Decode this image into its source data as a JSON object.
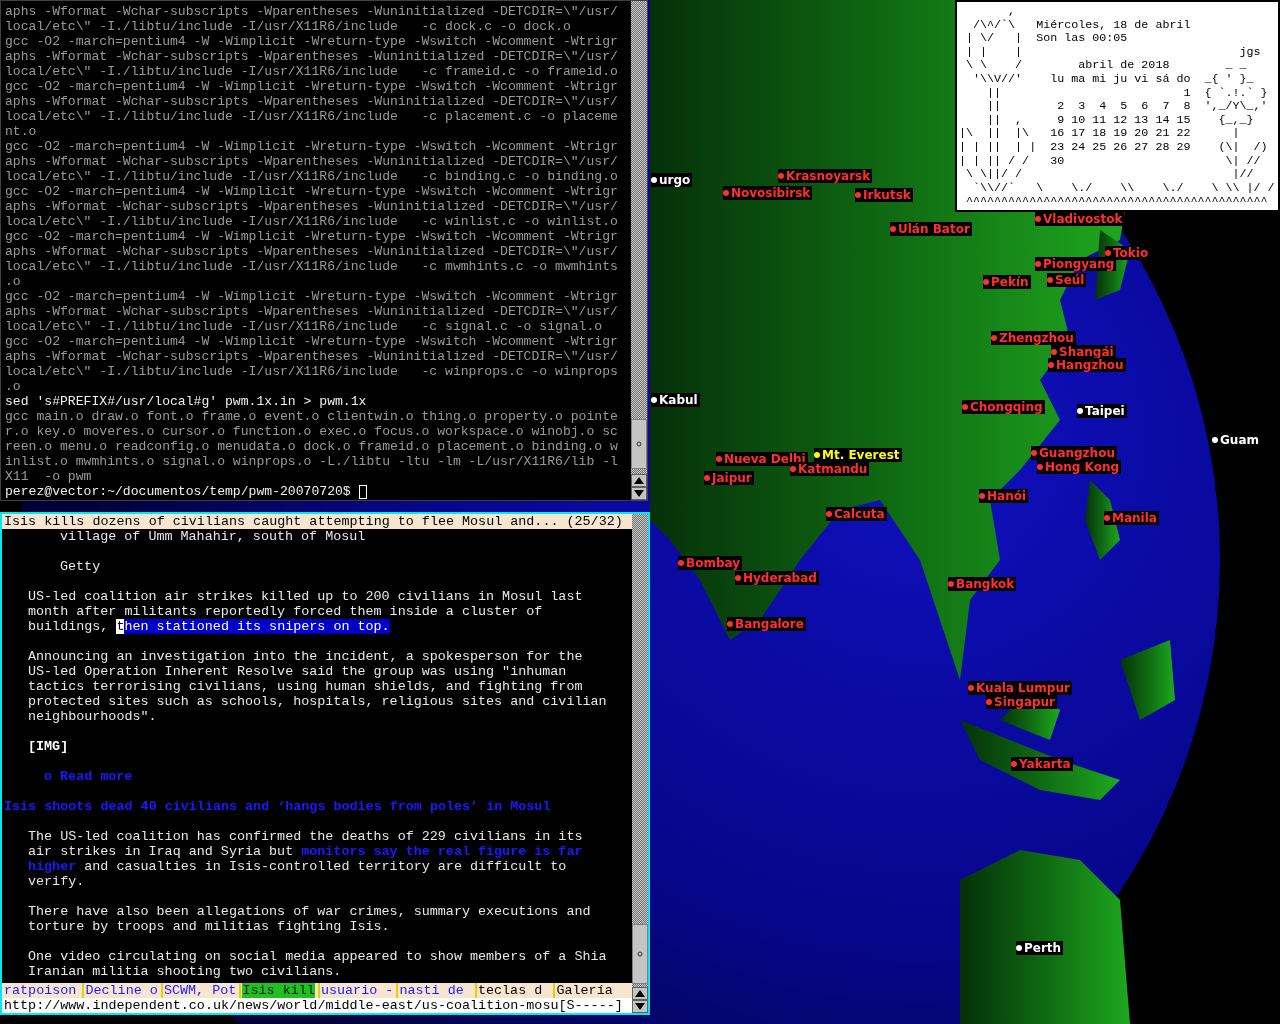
{
  "terminal": {
    "lines": [
      {
        "text": "aphs -Wformat -Wchar-subscripts -Wparentheses -Wuninitialized -DETCDIR=\\\"/usr/",
        "kind": "output"
      },
      {
        "text": "local/etc\\\" -I./libtu/include -I/usr/X11R6/include   -c dock.c -o dock.o",
        "kind": "output"
      },
      {
        "text": "gcc -O2 -march=pentium4 -W -Wimplicit -Wreturn-type -Wswitch -Wcomment -Wtrigr",
        "kind": "output"
      },
      {
        "text": "aphs -Wformat -Wchar-subscripts -Wparentheses -Wuninitialized -DETCDIR=\\\"/usr/",
        "kind": "output"
      },
      {
        "text": "local/etc\\\" -I./libtu/include -I/usr/X11R6/include   -c frameid.c -o frameid.o",
        "kind": "output"
      },
      {
        "text": "gcc -O2 -march=pentium4 -W -Wimplicit -Wreturn-type -Wswitch -Wcomment -Wtrigr",
        "kind": "output"
      },
      {
        "text": "aphs -Wformat -Wchar-subscripts -Wparentheses -Wuninitialized -DETCDIR=\\\"/usr/",
        "kind": "output"
      },
      {
        "text": "local/etc\\\" -I./libtu/include -I/usr/X11R6/include   -c placement.c -o placeme",
        "kind": "output"
      },
      {
        "text": "nt.o",
        "kind": "output"
      },
      {
        "text": "gcc -O2 -march=pentium4 -W -Wimplicit -Wreturn-type -Wswitch -Wcomment -Wtrigr",
        "kind": "output"
      },
      {
        "text": "aphs -Wformat -Wchar-subscripts -Wparentheses -Wuninitialized -DETCDIR=\\\"/usr/",
        "kind": "output"
      },
      {
        "text": "local/etc\\\" -I./libtu/include -I/usr/X11R6/include   -c binding.c -o binding.o",
        "kind": "output"
      },
      {
        "text": "gcc -O2 -march=pentium4 -W -Wimplicit -Wreturn-type -Wswitch -Wcomment -Wtrigr",
        "kind": "output"
      },
      {
        "text": "aphs -Wformat -Wchar-subscripts -Wparentheses -Wuninitialized -DETCDIR=\\\"/usr/",
        "kind": "output"
      },
      {
        "text": "local/etc\\\" -I./libtu/include -I/usr/X11R6/include   -c winlist.c -o winlist.o",
        "kind": "output"
      },
      {
        "text": "gcc -O2 -march=pentium4 -W -Wimplicit -Wreturn-type -Wswitch -Wcomment -Wtrigr",
        "kind": "output"
      },
      {
        "text": "aphs -Wformat -Wchar-subscripts -Wparentheses -Wuninitialized -DETCDIR=\\\"/usr/",
        "kind": "output"
      },
      {
        "text": "local/etc\\\" -I./libtu/include -I/usr/X11R6/include   -c mwmhints.c -o mwmhints",
        "kind": "output"
      },
      {
        "text": ".o",
        "kind": "output"
      },
      {
        "text": "gcc -O2 -march=pentium4 -W -Wimplicit -Wreturn-type -Wswitch -Wcomment -Wtrigr",
        "kind": "output"
      },
      {
        "text": "aphs -Wformat -Wchar-subscripts -Wparentheses -Wuninitialized -DETCDIR=\\\"/usr/",
        "kind": "output"
      },
      {
        "text": "local/etc\\\" -I./libtu/include -I/usr/X11R6/include   -c signal.c -o signal.o",
        "kind": "output"
      },
      {
        "text": "gcc -O2 -march=pentium4 -W -Wimplicit -Wreturn-type -Wswitch -Wcomment -Wtrigr",
        "kind": "output"
      },
      {
        "text": "aphs -Wformat -Wchar-subscripts -Wparentheses -Wuninitialized -DETCDIR=\\\"/usr/",
        "kind": "output"
      },
      {
        "text": "local/etc\\\" -I./libtu/include -I/usr/X11R6/include   -c winprops.c -o winprops",
        "kind": "output"
      },
      {
        "text": ".o",
        "kind": "output"
      },
      {
        "text": "sed 's#PREFIX#/usr/local#g' pwm.1x.in > pwm.1x",
        "kind": "command"
      },
      {
        "text": "gcc main.o draw.o font.o frame.o event.o clientwin.o thing.o property.o pointe",
        "kind": "output"
      },
      {
        "text": "r.o key.o moveres.o cursor.o function.o exec.o focus.o workspace.o winobj.o sc",
        "kind": "output"
      },
      {
        "text": "reen.o menu.o readconfig.o menudata.o dock.o frameid.o placement.o binding.o w",
        "kind": "output"
      },
      {
        "text": "inlist.o mwmhints.o signal.o winprops.o -L./libtu -ltu -lm -L/usr/X11R6/lib -l",
        "kind": "output"
      },
      {
        "text": "X11  -o pwm",
        "kind": "output"
      },
      {
        "text": "perez@vector:~/documentos/temp/pwm-20070720$",
        "kind": "prompt"
      }
    ]
  },
  "browser": {
    "title": "Isis kills dozens of civilians caught attempting to flee Mosul and... (25/32)",
    "paragraphs": [
      {
        "kind": "caption",
        "lines": [
          [
            {
              "text": "village of Umm Mahahir, south of Mosul",
              "kind": "plain"
            }
          ]
        ]
      },
      {
        "kind": "caption",
        "lines": [
          [
            {
              "text": "Getty",
              "kind": "plain"
            }
          ]
        ]
      },
      {
        "kind": "body",
        "lines": [
          [
            {
              "text": "US-led coalition air strikes killed up to 200 civilians in Mosul last",
              "kind": "plain"
            }
          ],
          [
            {
              "text": "month after militants reportedly forced them inside a cluster of",
              "kind": "plain"
            }
          ],
          [
            {
              "text": "buildings, ",
              "kind": "plain"
            },
            {
              "text": "t",
              "kind": "cursor"
            },
            {
              "text": "hen stationed its snipers on top.",
              "kind": "highlight"
            }
          ]
        ]
      },
      {
        "kind": "body",
        "lines": [
          [
            {
              "text": "Announcing an investigation into the incident, a spokesperson for the",
              "kind": "plain"
            }
          ],
          [
            {
              "text": "US-led Operation Inherent Resolve said the group was using \"inhuman",
              "kind": "plain"
            }
          ],
          [
            {
              "text": "tactics terrorising civilians, using human shields, and fighting from",
              "kind": "plain"
            }
          ],
          [
            {
              "text": "protected sites such as schools, hospitals, religious sites and civilian",
              "kind": "plain"
            }
          ],
          [
            {
              "text": "neighbourhoods\".",
              "kind": "plain"
            }
          ]
        ]
      },
      {
        "kind": "image",
        "lines": [
          [
            {
              "text": "[IMG]",
              "kind": "plain"
            }
          ]
        ]
      },
      {
        "kind": "more",
        "lines": [
          [
            {
              "text": "o Read more",
              "kind": "link"
            }
          ]
        ]
      },
      {
        "kind": "heading",
        "lines": [
          [
            {
              "text": "Isis shoots dead 40 civilians and ‘hangs bodies from poles’ in Mosul",
              "kind": "link"
            }
          ]
        ]
      },
      {
        "kind": "body",
        "lines": [
          [
            {
              "text": "The US-led coalition has confirmed the deaths of 229 civilians in its",
              "kind": "plain"
            }
          ],
          [
            {
              "text": "air strikes in Iraq and Syria but ",
              "kind": "plain"
            },
            {
              "text": "monitors say the real figure is far",
              "kind": "link"
            }
          ],
          [
            {
              "text": "higher",
              "kind": "link"
            },
            {
              "text": " and casualties in Isis-controlled territory are difficult to",
              "kind": "plain"
            }
          ],
          [
            {
              "text": "verify.",
              "kind": "plain"
            }
          ]
        ]
      },
      {
        "kind": "body",
        "lines": [
          [
            {
              "text": "There have also been allegations of war crimes, summary executions and",
              "kind": "plain"
            }
          ],
          [
            {
              "text": "torture by troops and militias fighting Isis.",
              "kind": "plain"
            }
          ]
        ]
      },
      {
        "kind": "body",
        "lines": [
          [
            {
              "text": "One video circulating on social media appeared to show members of a Shia",
              "kind": "plain"
            }
          ],
          [
            {
              "text": "Iranian militia shooting two civilians.",
              "kind": "plain"
            }
          ]
        ]
      }
    ],
    "tabs": [
      {
        "label": "ratpoison",
        "selected": false,
        "kind": "link"
      },
      {
        "label": "Decline o",
        "selected": false,
        "kind": "link"
      },
      {
        "label": "SCWM, Pot",
        "selected": false,
        "kind": "link"
      },
      {
        "label": "Isis kill",
        "selected": true,
        "kind": "link"
      },
      {
        "label": "usuario -",
        "selected": false,
        "kind": "link"
      },
      {
        "label": "nasti de",
        "selected": false,
        "kind": "link"
      },
      {
        "label": "teclas d",
        "selected": false,
        "kind": "plain"
      },
      {
        "label": "Galería",
        "selected": false,
        "kind": "plain"
      }
    ],
    "status_url": "http://www.independent.co.uk/news/world/middle-east/us-coalition-mosu[S-----]"
  },
  "calendar": {
    "lines": [
      "       ,",
      "  /\\^/`\\   Miércoles, 18 de abril",
      " | \\/   |  Son las 00:05",
      " | |    |                               jgs",
      " \\ \\    /        abril de 2018        _ _",
      "  '\\\\V//'    lu ma mi ju vi sá do  _{ ' }_",
      "    ||                          1  { `.!.` }",
      "    ||        2  3  4  5  6  7  8  ',_/Y\\_,'",
      "    ||  ,     9 10 11 12 13 14 15    {_,_}",
      "|\\  ||  |\\   16 17 18 19 20 21 22      |",
      "| | ||  | |  23 24 25 26 27 28 29    (\\|  /)",
      "| | || / /   30                       \\| //",
      " \\ \\||/ /                              |//",
      "  `\\\\//`   \\    \\./    \\\\    \\./    \\ \\\\ |/ /",
      " ^^^^^^^^^^^^^^^^^^^^^^^^^^^^^^^^^^^^^^^^^^^"
    ]
  },
  "map": {
    "cities": [
      {
        "name": "urgo",
        "color": "#ffffff"
      },
      {
        "name": "Krasnoyarsk",
        "color": "#ff3030"
      },
      {
        "name": "Novosibirsk",
        "color": "#ff3030"
      },
      {
        "name": "Irkutsk",
        "color": "#ff3030"
      },
      {
        "name": "Vladivostok",
        "color": "#ff3030"
      },
      {
        "name": "Ulán Bator",
        "color": "#ff3030"
      },
      {
        "name": "Tokio",
        "color": "#ff3030"
      },
      {
        "name": "Piongyang",
        "color": "#ff3030"
      },
      {
        "name": "Seúl",
        "color": "#ff3030"
      },
      {
        "name": "Pekín",
        "color": "#ff3030"
      },
      {
        "name": "Zhengzhou",
        "color": "#ff3030"
      },
      {
        "name": "Shangái",
        "color": "#ff3030"
      },
      {
        "name": "Hangzhou",
        "color": "#ff3030"
      },
      {
        "name": "Kabul",
        "color": "#ffffff"
      },
      {
        "name": "Chongqing",
        "color": "#ff3030"
      },
      {
        "name": "Taipei",
        "color": "#ffffff"
      },
      {
        "name": "Guam",
        "color": "#ffffff"
      },
      {
        "name": "Nueva Delhi",
        "color": "#ff3030"
      },
      {
        "name": "Mt. Everest",
        "color": "#ffff00"
      },
      {
        "name": "Katmandu",
        "color": "#ff3030"
      },
      {
        "name": "Guangzhou",
        "color": "#ff3030"
      },
      {
        "name": "Hong Kong",
        "color": "#ff3030"
      },
      {
        "name": "Jaipur",
        "color": "#ff3030"
      },
      {
        "name": "Hanói",
        "color": "#ff3030"
      },
      {
        "name": "Calcuta",
        "color": "#ff3030"
      },
      {
        "name": "Manila",
        "color": "#ff3030"
      },
      {
        "name": "Bombay",
        "color": "#ff3030"
      },
      {
        "name": "Hyderabad",
        "color": "#ff3030"
      },
      {
        "name": "Bangkok",
        "color": "#ff3030"
      },
      {
        "name": "Bangalore",
        "color": "#ff3030"
      },
      {
        "name": "Kuala Lumpur",
        "color": "#ff3030"
      },
      {
        "name": "Singapur",
        "color": "#ff3030"
      },
      {
        "name": "Yakarta",
        "color": "#ff3030"
      },
      {
        "name": "Perth",
        "color": "#ffffff"
      }
    ]
  }
}
